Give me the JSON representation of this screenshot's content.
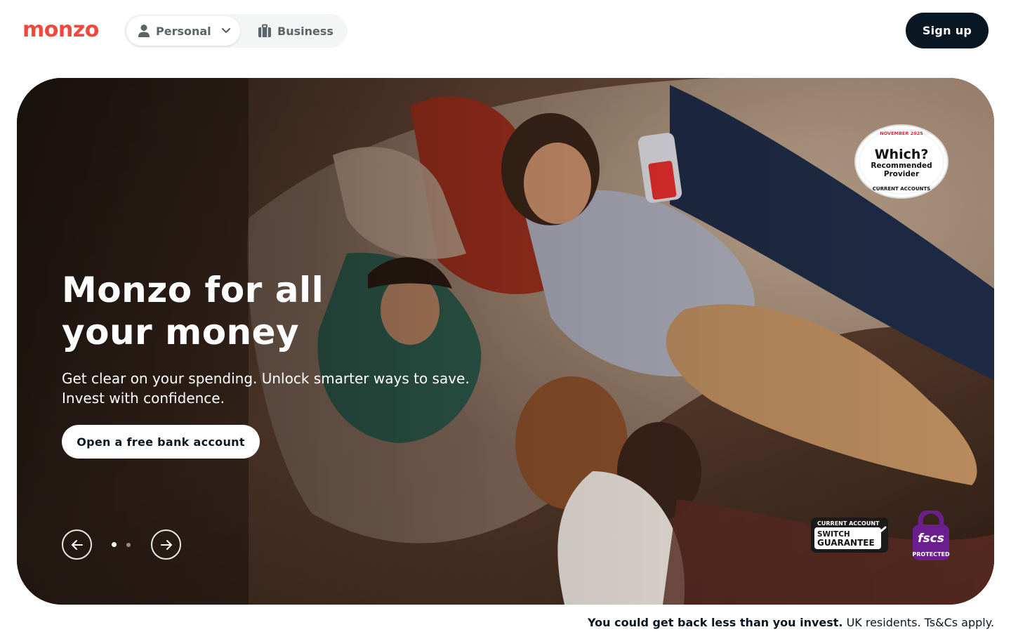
{
  "brand": {
    "name": "monzo",
    "color": "#f0483e"
  },
  "nav": {
    "personal_label": "Personal",
    "business_label": "Business",
    "signup_label": "Sign up"
  },
  "hero": {
    "headline_line1": "Monzo for all",
    "headline_line2": "your money",
    "subtext_line1": "Get clear on your spending. Unlock smarter ways to save.",
    "subtext_line2": "Invest with confidence.",
    "cta_label": "Open a free bank account",
    "carousel": {
      "total_slides": 2,
      "active_slide": 1
    }
  },
  "badges": {
    "which_top": "NOVEMBER 2025",
    "which_title": "Which?",
    "which_line1": "Recommended",
    "which_line2": "Provider",
    "which_bottom": "CURRENT ACCOUNTS",
    "switch_top": "CURRENT ACCOUNT",
    "switch_line1": "SWITCH",
    "switch_line2": "GUARANTEE",
    "fscs_title": "fscs",
    "fscs_bottom": "PROTECTED"
  },
  "disclaimer": {
    "bold": "You could get back less than you invest.",
    "rest": " UK residents. Ts&Cs apply."
  },
  "colors": {
    "dark": "#091723",
    "segment_bg": "#f4f6f5",
    "fscs_purple": "#6b1f8f"
  }
}
